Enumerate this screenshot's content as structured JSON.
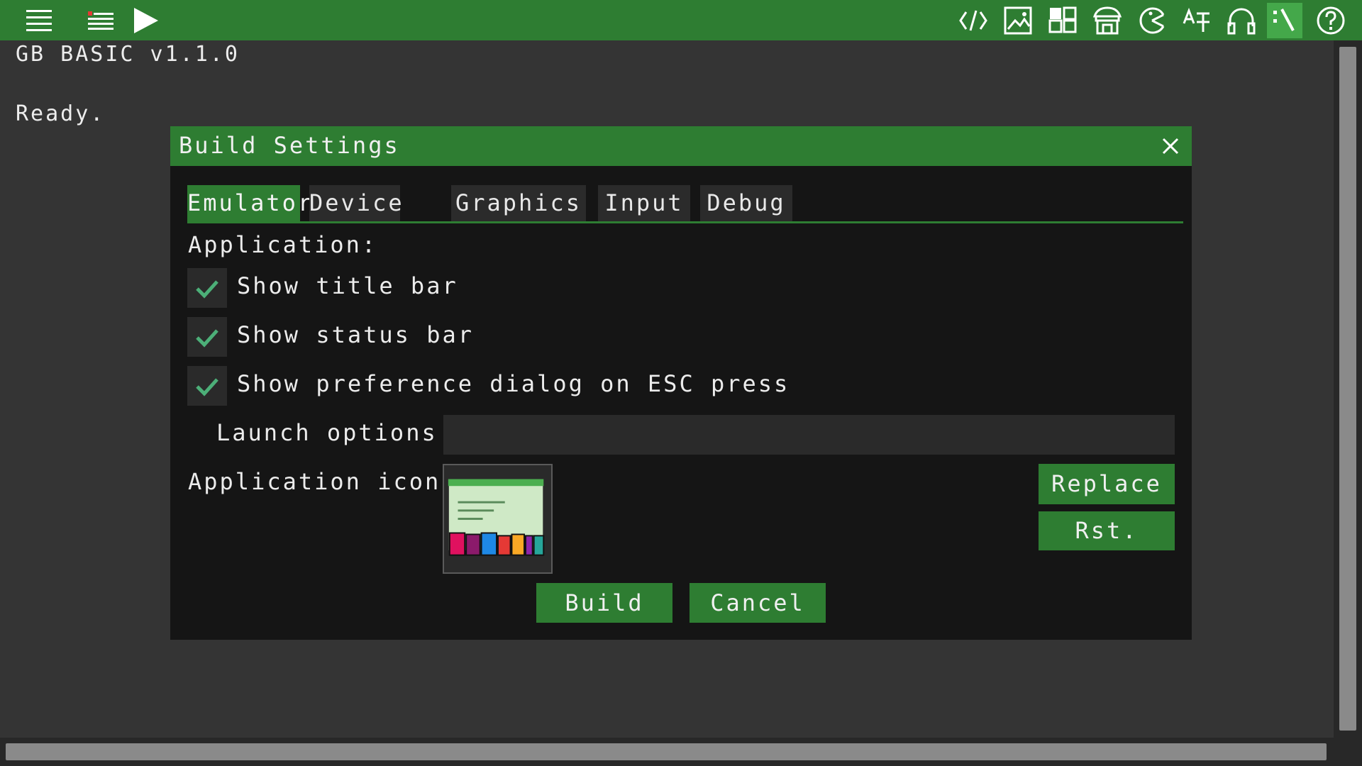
{
  "toolbar": {
    "left_items": [
      {
        "name": "menu-icon"
      },
      {
        "name": "list-icon"
      },
      {
        "name": "play-icon"
      }
    ],
    "right_items": [
      {
        "name": "code-icon"
      },
      {
        "name": "image-icon"
      },
      {
        "name": "tiles-icon"
      },
      {
        "name": "shop-icon"
      },
      {
        "name": "sprite-icon"
      },
      {
        "name": "font-icon"
      },
      {
        "name": "headphones-icon"
      },
      {
        "name": "terminal-icon",
        "active": true
      },
      {
        "name": "help-icon"
      }
    ],
    "color": "#2e7d32",
    "active_color": "#44a84a"
  },
  "console": {
    "version_line": "GB BASIC v1.1.0",
    "status_line": "Ready."
  },
  "dialog": {
    "title": "Build Settings",
    "tabs": [
      {
        "label": "Emulator",
        "active": true
      },
      {
        "label": "Device",
        "active": false
      },
      {
        "label": "Graphics",
        "active": false
      },
      {
        "label": "Input",
        "active": false
      },
      {
        "label": "Debug",
        "active": false
      }
    ],
    "section_heading": "Application:",
    "checkboxes": [
      {
        "label": "Show title bar",
        "checked": true
      },
      {
        "label": "Show status bar",
        "checked": true
      },
      {
        "label": "Show preference dialog on ESC press",
        "checked": true
      }
    ],
    "launch_options_label": "Launch options",
    "launch_options_value": "",
    "app_icon_label": "Application icon",
    "replace_label": "Replace",
    "reset_label": "Rst.",
    "build_label": "Build",
    "cancel_label": "Cancel"
  },
  "colors": {
    "accent": "#2e7d32",
    "check": "#4caf78",
    "background": "#343434",
    "dialog": "#151515"
  }
}
